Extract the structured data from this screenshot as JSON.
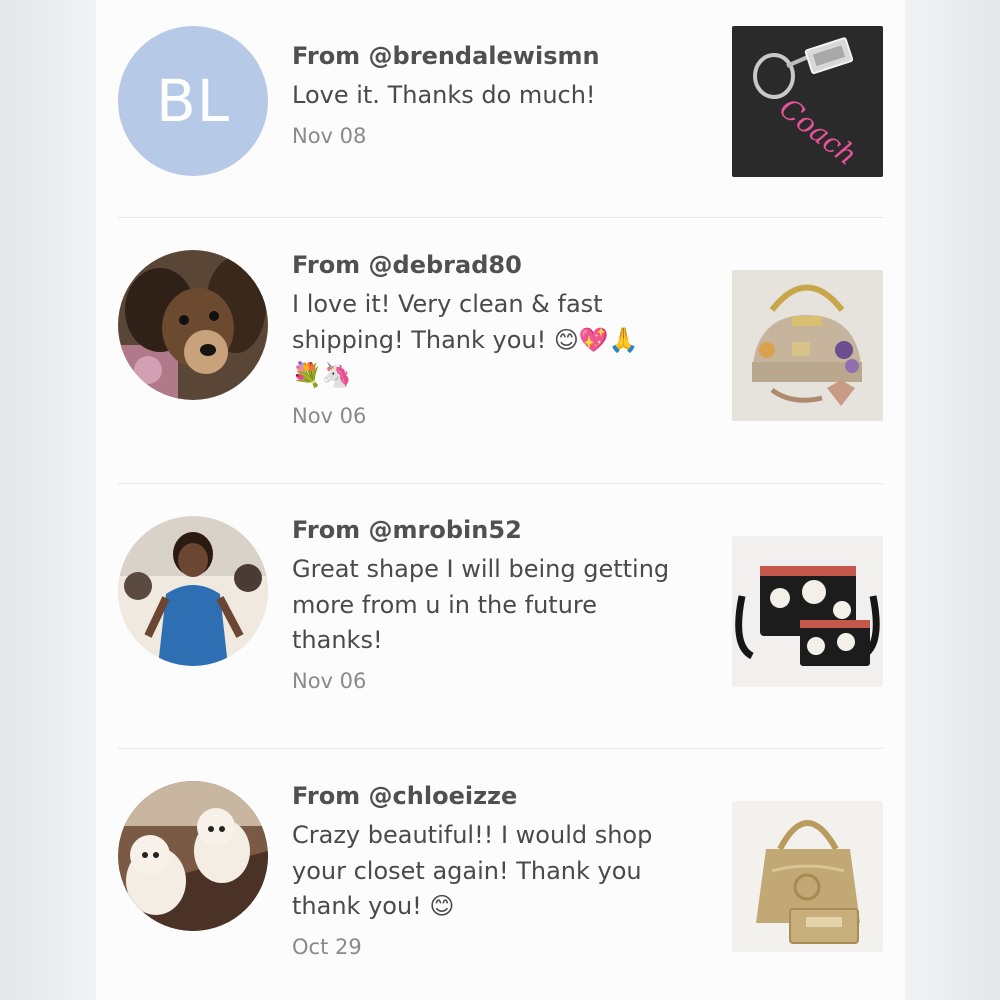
{
  "reviews": [
    {
      "from": "From @brendalewismn",
      "avatar_initials": "BL",
      "comment": "Love it. Thanks do much!",
      "date": "Nov 08",
      "thumbnail_text": "Coach"
    },
    {
      "from": "From @debrad80",
      "comment_line1": "I love it! Very clean & fast",
      "comment_line2": "shipping! Thank you! 😊💖🙏",
      "comment_line3": "💐🦄",
      "date": "Nov 06"
    },
    {
      "from": "From @mrobin52",
      "comment_line1": "Great shape I will being getting",
      "comment_line2": "more from u in the future",
      "comment_line3": "thanks!",
      "date": "Nov 06"
    },
    {
      "from": "From @chloeizze",
      "comment_line1": "Crazy beautiful!! I would shop",
      "comment_line2": "your closet again! Thank you",
      "comment_line3": "thank you! 😊",
      "date": "Oct 29"
    }
  ]
}
